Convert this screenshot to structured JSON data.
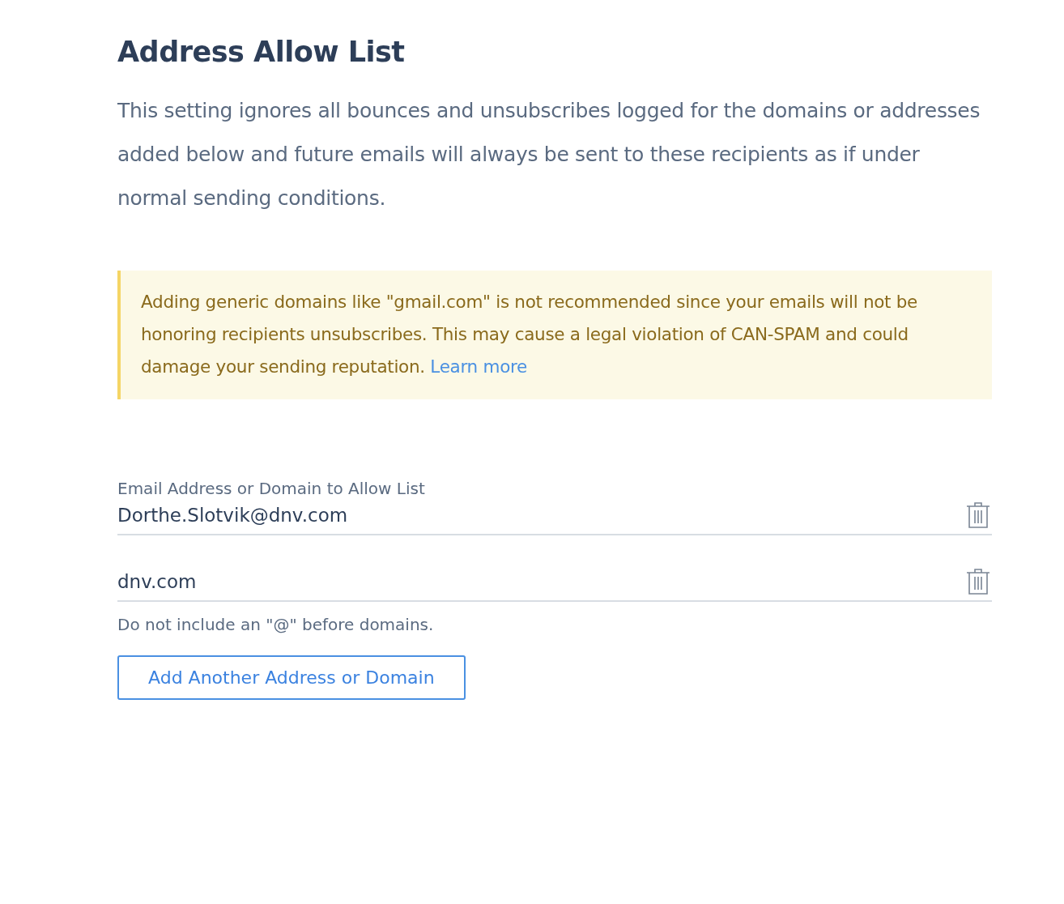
{
  "title": "Address Allow List",
  "description": "This setting ignores all bounces and unsubscribes logged for the domains or addresses added below and future emails will always be sent to these recipients as if under normal sending conditions.",
  "warning": {
    "text": "Adding generic domains like \"gmail.com\" is not recommended since your emails will not be honoring recipients unsubscribes. This may cause a legal violation of CAN-SPAM and could damage your sending reputation.",
    "link": "Learn more"
  },
  "entries": [
    {
      "label": "Email Address or Domain to Allow List",
      "value": "Dorthe.Slotvik@dnv.com"
    },
    {
      "value": "dnv.com"
    }
  ],
  "hint": "Do not include an \"@\" before domains.",
  "add_button": "Add Another Address or Domain"
}
